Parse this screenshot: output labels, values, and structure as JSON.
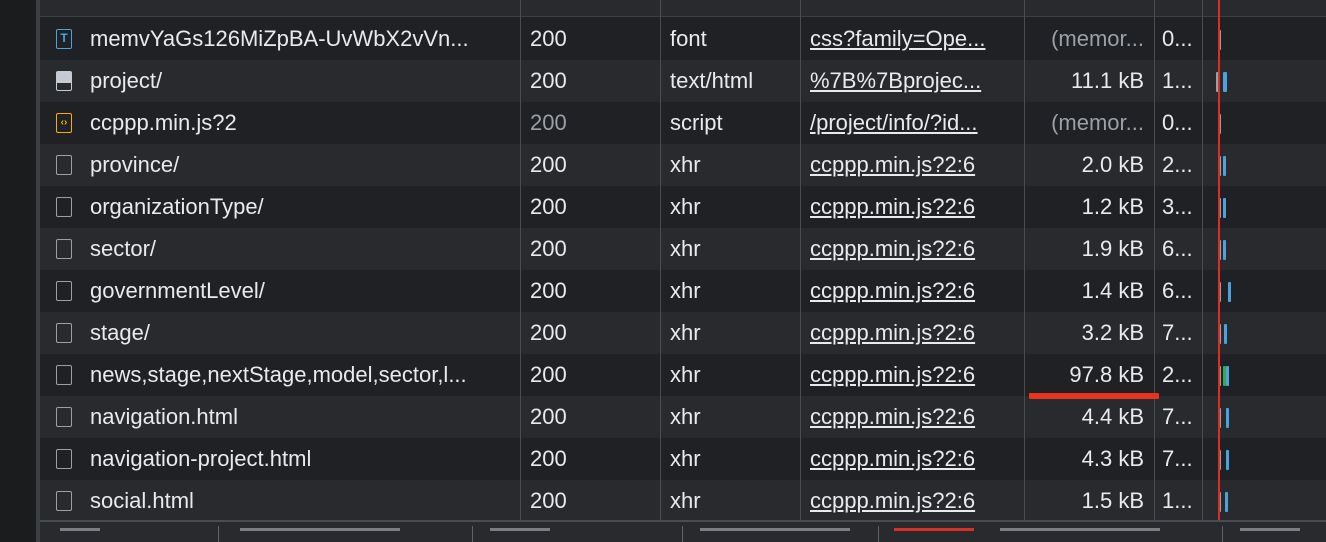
{
  "network_table": {
    "rows": [
      {
        "name": "memvYaGs126MiZpBA-UvWbX2vVn...",
        "status": "200",
        "type": "font",
        "initiator": "css?family=Ope...",
        "size": "(memor...",
        "time": "0...",
        "icon": "font-file-icon",
        "dim_status": false,
        "dim_size": true
      },
      {
        "name": "project/",
        "status": "200",
        "type": "text/html",
        "initiator": "%7B%7Bprojec...",
        "size": "11.1 kB",
        "time": "1...",
        "icon": "document-icon",
        "dim_status": false,
        "dim_size": false
      },
      {
        "name": "ccppp.min.js?2",
        "status": "200",
        "type": "script",
        "initiator": "/project/info/?id...",
        "size": "(memor...",
        "time": "0...",
        "icon": "script-file-icon",
        "dim_status": true,
        "dim_size": true
      },
      {
        "name": "province/",
        "status": "200",
        "type": "xhr",
        "initiator": "ccppp.min.js?2:6",
        "size": "2.0 kB",
        "time": "2...",
        "icon": "blank-file-icon",
        "dim_status": false,
        "dim_size": false
      },
      {
        "name": "organizationType/",
        "status": "200",
        "type": "xhr",
        "initiator": "ccppp.min.js?2:6",
        "size": "1.2 kB",
        "time": "3...",
        "icon": "blank-file-icon",
        "dim_status": false,
        "dim_size": false
      },
      {
        "name": "sector/",
        "status": "200",
        "type": "xhr",
        "initiator": "ccppp.min.js?2:6",
        "size": "1.9 kB",
        "time": "6...",
        "icon": "blank-file-icon",
        "dim_status": false,
        "dim_size": false
      },
      {
        "name": "governmentLevel/",
        "status": "200",
        "type": "xhr",
        "initiator": "ccppp.min.js?2:6",
        "size": "1.4 kB",
        "time": "6...",
        "icon": "blank-file-icon",
        "dim_status": false,
        "dim_size": false
      },
      {
        "name": "stage/",
        "status": "200",
        "type": "xhr",
        "initiator": "ccppp.min.js?2:6",
        "size": "3.2 kB",
        "time": "7...",
        "icon": "blank-file-icon",
        "dim_status": false,
        "dim_size": false
      },
      {
        "name": "news,stage,nextStage,model,sector,l...",
        "status": "200",
        "type": "xhr",
        "initiator": "ccppp.min.js?2:6",
        "size": "97.8 kB",
        "time": "2...",
        "icon": "blank-file-icon",
        "dim_status": false,
        "dim_size": false
      },
      {
        "name": "navigation.html",
        "status": "200",
        "type": "xhr",
        "initiator": "ccppp.min.js?2:6",
        "size": "4.4 kB",
        "time": "7...",
        "icon": "blank-file-icon",
        "dim_status": false,
        "dim_size": false
      },
      {
        "name": "navigation-project.html",
        "status": "200",
        "type": "xhr",
        "initiator": "ccppp.min.js?2:6",
        "size": "4.3 kB",
        "time": "7...",
        "icon": "blank-file-icon",
        "dim_status": false,
        "dim_size": false
      },
      {
        "name": "social.html",
        "status": "200",
        "type": "xhr",
        "initiator": "ccppp.min.js?2:6",
        "size": "1.5 kB",
        "time": "1...",
        "icon": "blank-file-icon",
        "dim_status": false,
        "dim_size": false
      }
    ]
  },
  "icon_glyphs": {
    "font": "T",
    "script": "‹›"
  },
  "colors": {
    "waterfall_bar": "#4aa3df",
    "waterfall_wait": "#9aa0a6",
    "waterfall_green": "#34a853",
    "load_line": "#d93025",
    "highlight_mark": "#e8331d"
  }
}
